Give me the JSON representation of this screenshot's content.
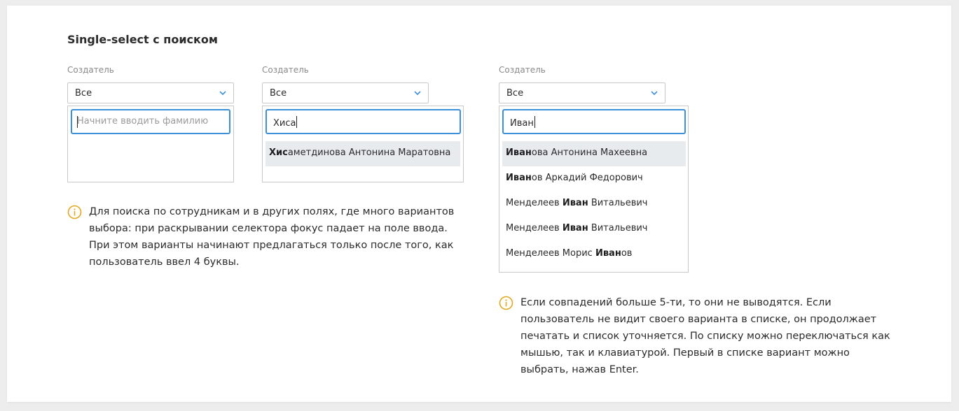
{
  "section": {
    "title": "Single-select с поиском"
  },
  "colors": {
    "accent": "#3d8fd8",
    "info_icon": "#e3a81c",
    "highlight": "#e8ebee"
  },
  "examples": [
    {
      "label": "Создатель",
      "select_value": "Все",
      "search": {
        "value": "",
        "placeholder": "Начните вводить фамилию"
      },
      "options": []
    },
    {
      "label": "Создатель",
      "select_value": "Все",
      "search": {
        "value": "Хиса",
        "placeholder": ""
      },
      "options": [
        {
          "bold": "Хис",
          "rest": "аметдинова Антонина Маратовна"
        }
      ]
    },
    {
      "label": "Создатель",
      "select_value": "Все",
      "search": {
        "value": "Иван",
        "placeholder": ""
      },
      "options": [
        {
          "pre": "",
          "bold": "Иван",
          "post": "ова Антонина Махеевна"
        },
        {
          "pre": "",
          "bold": "Иван",
          "post": "ов Аркадий Федорович"
        },
        {
          "pre": "Менделеев ",
          "bold": "Иван",
          "post": " Витальевич"
        },
        {
          "pre": "Менделеев ",
          "bold": "Иван",
          "post": " Витальевич"
        },
        {
          "pre": "Менделеев Морис ",
          "bold": "Иван",
          "post": "ов"
        }
      ]
    }
  ],
  "notes": {
    "left": [
      "Для поиска по сотрудникам и в других полях, где много вариантов",
      "выбора: при раскрывании селектора фокус падает на поле ввода.",
      "При этом варианты начинают предлагаться только после того, как",
      "пользователь ввел 4 буквы."
    ],
    "right": [
      "Если совпадений больше 5-ти, то они не выводятся. Если",
      "пользователь не видит своего варианта в списке, он продолжает",
      "печатать и список уточняется. По списку можно переключаться как",
      "мышью, так и клавиатурой. Первый в списке вариант можно",
      "выбрать, нажав Enter."
    ]
  },
  "icons": {
    "chevron": "chevron-down-icon",
    "info": "info-icon"
  }
}
